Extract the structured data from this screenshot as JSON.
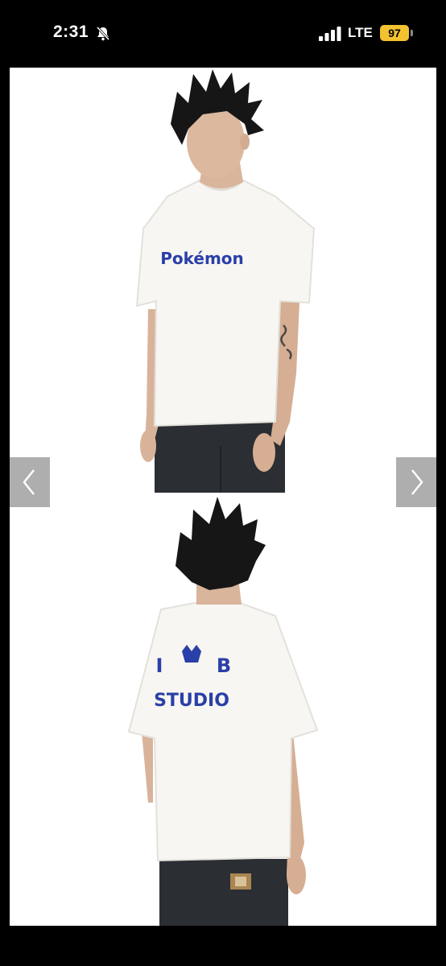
{
  "status_bar": {
    "time": "2:31",
    "network": "LTE",
    "battery": "97",
    "battery_color": "#f2c230"
  },
  "gallery": {
    "front_logo_text": "Pokémon",
    "back_letters": [
      "I",
      "B"
    ],
    "back_text": "STUDIO",
    "print_color": "#2a3fa8",
    "prev_icon": "chevron-left-icon",
    "next_icon": "chevron-right-icon"
  }
}
